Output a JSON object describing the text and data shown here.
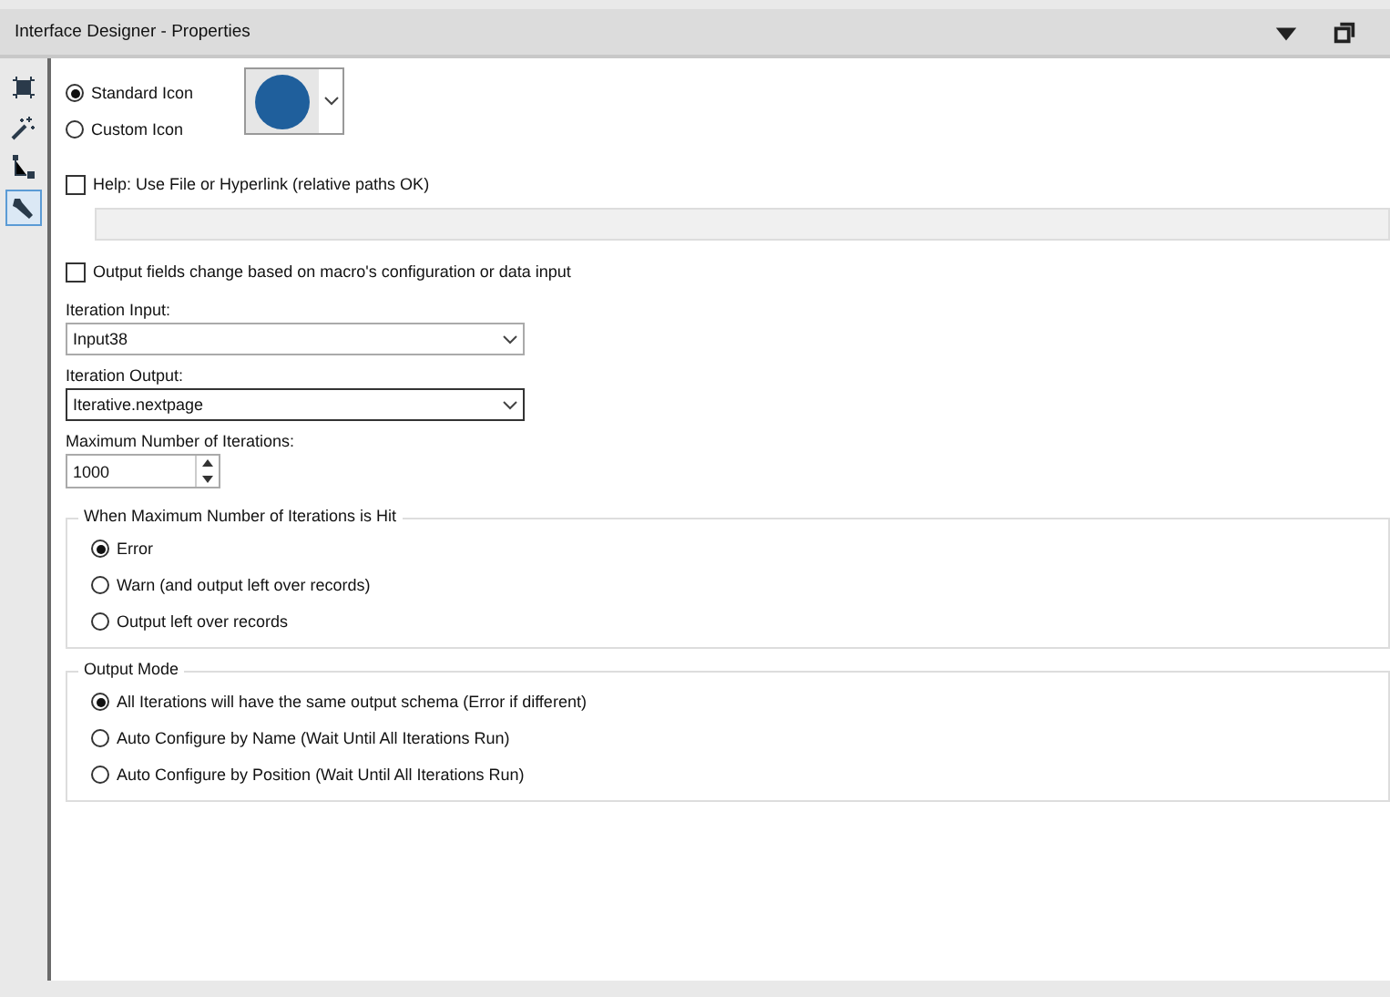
{
  "window": {
    "title": "Interface Designer - Properties"
  },
  "tools": [
    {
      "kind": "layout",
      "selected": false
    },
    {
      "kind": "wand",
      "selected": false
    },
    {
      "kind": "tree",
      "selected": false
    },
    {
      "kind": "wrench",
      "selected": true
    }
  ],
  "icon_options": [
    {
      "label": "Standard Icon",
      "selected": true
    },
    {
      "label": "Custom Icon",
      "selected": false
    }
  ],
  "icon_picker": {
    "color": "#1f5f9c"
  },
  "help": {
    "label": "Help: Use File or Hyperlink (relative paths OK)",
    "checked": false
  },
  "output_fields": {
    "label": "Output fields change based on macro's configuration or data input",
    "checked": false
  },
  "iteration_input": {
    "label": "Iteration Input:",
    "value": "Input38"
  },
  "iteration_output": {
    "label": "Iteration Output:",
    "value": "Iterative.nextpage",
    "focused": true
  },
  "max_iterations": {
    "label": "Maximum Number of Iterations:",
    "value": "1000"
  },
  "groups": [
    {
      "title": "When Maximum Number of Iterations is Hit",
      "options": [
        {
          "label": "Error",
          "selected": true
        },
        {
          "label": "Warn (and output left over records)",
          "selected": false
        },
        {
          "label": "Output left over records",
          "selected": false
        }
      ]
    },
    {
      "title": "Output Mode",
      "options": [
        {
          "label": "All Iterations will have the same output schema (Error if different)",
          "selected": true
        },
        {
          "label": "Auto Configure by Name (Wait Until All Iterations Run)",
          "selected": false
        },
        {
          "label": "Auto Configure by Position (Wait Until All Iterations Run)",
          "selected": false
        }
      ]
    }
  ]
}
